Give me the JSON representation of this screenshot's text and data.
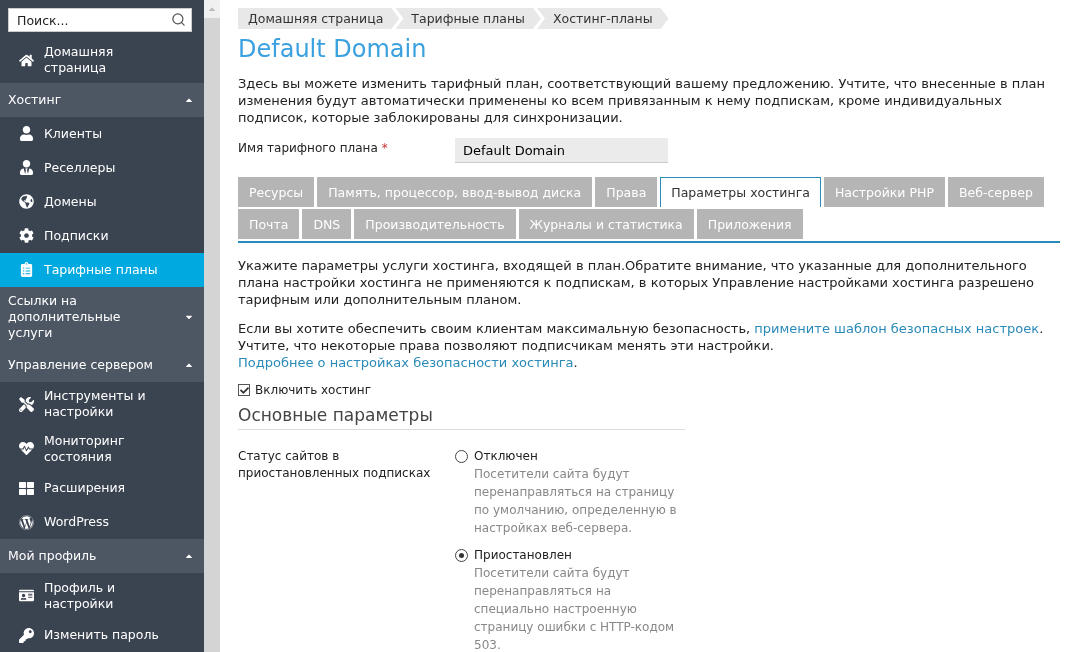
{
  "sidebar": {
    "search": {
      "placeholder": "Поиск..."
    },
    "sections": [
      {
        "kind": "item",
        "label": "Домашняя страница",
        "selected": false
      },
      {
        "kind": "group",
        "label": "Хостинг",
        "expanded": true,
        "items": [
          {
            "label": "Клиенты",
            "selected": false
          },
          {
            "label": "Реселлеры",
            "selected": false
          },
          {
            "label": "Домены",
            "selected": false
          },
          {
            "label": "Подписки",
            "selected": false
          },
          {
            "label": "Тарифные планы",
            "selected": true
          }
        ]
      },
      {
        "kind": "group",
        "label": "Ссылки на дополнительные услуги",
        "expanded": false
      },
      {
        "kind": "group",
        "label": "Управление сервером",
        "expanded": true,
        "items": [
          {
            "label": "Инструменты и настройки",
            "selected": false
          },
          {
            "label": "Мониторинг состояния",
            "selected": false
          },
          {
            "label": "Расширения",
            "selected": false
          },
          {
            "label": "WordPress",
            "selected": false
          }
        ]
      },
      {
        "kind": "group",
        "label": "Мой профиль",
        "expanded": true,
        "items": [
          {
            "label": "Профиль и настройки",
            "selected": false
          },
          {
            "label": "Изменить пароль",
            "selected": false
          }
        ]
      }
    ]
  },
  "breadcrumbs": [
    "Домашняя страница",
    "Тарифные планы",
    "Хостинг-планы"
  ],
  "title": "Default Domain",
  "intro": "Здесь вы можете изменить тарифный план, соответствующий вашему предложению. Учтите, что внесенные в план изменения будут автоматически применены ко всем привязанным к нему подпискам, кроме индивидуальных подписок, которые заблокированы для синхронизации.",
  "plan_name": {
    "label": "Имя тарифного плана",
    "required_mark": "*",
    "value": "Default Domain"
  },
  "tab_rows": [
    [
      {
        "label": "Ресурсы",
        "selected": false
      },
      {
        "label": "Память, процессор, ввод-вывод диска",
        "selected": false
      },
      {
        "label": "Права",
        "selected": false
      },
      {
        "label": "Параметры хостинга",
        "selected": true
      },
      {
        "label": "Настройки PHP",
        "selected": false
      },
      {
        "label": "Веб-сервер",
        "selected": false
      }
    ],
    [
      {
        "label": "Почта",
        "selected": false
      },
      {
        "label": "DNS",
        "selected": false
      },
      {
        "label": "Производительность",
        "selected": false
      },
      {
        "label": "Журналы и статистика",
        "selected": false
      },
      {
        "label": "Приложения",
        "selected": false
      }
    ]
  ],
  "paragraphs": [
    [
      {
        "kind": "text",
        "text": "Укажите параметры услуги хостинга, входящей в план.Обратите внимание, что указанные для дополнительного плана настройки хостинга не применяются к подпискам, в которых Управление настройками хостинга разрешено тарифным или дополнительным планом."
      }
    ],
    [
      {
        "kind": "text",
        "text": "Если вы хотите обеспечить своим клиентам максимальную безопасность, "
      },
      {
        "kind": "link",
        "text": "примените шаблон безопасных настроек"
      },
      {
        "kind": "text",
        "text": ". Учтите, что некоторые права позволяют подписчикам менять эти настройки. "
      },
      {
        "kind": "link",
        "text": "Подробнее о настройках безопасности хостинга"
      },
      {
        "kind": "text",
        "text": "."
      }
    ]
  ],
  "enable_hosting": {
    "label": "Включить хостинг",
    "checked": true
  },
  "section_title": "Основные параметры",
  "suspended_status": {
    "label": "Статус сайтов в приостановленных подписках",
    "options": [
      {
        "label": "Отключен",
        "hint": "Посетители сайта будут перенаправляться на страницу по умолчанию, определенную в настройках веб-сервера.",
        "selected": false
      },
      {
        "label": "Приостановлен",
        "hint": "Посетители сайта будут перенаправляться на специально настроенную страницу ошибки с HTTP-кодом 503.",
        "selected": true
      }
    ]
  }
}
